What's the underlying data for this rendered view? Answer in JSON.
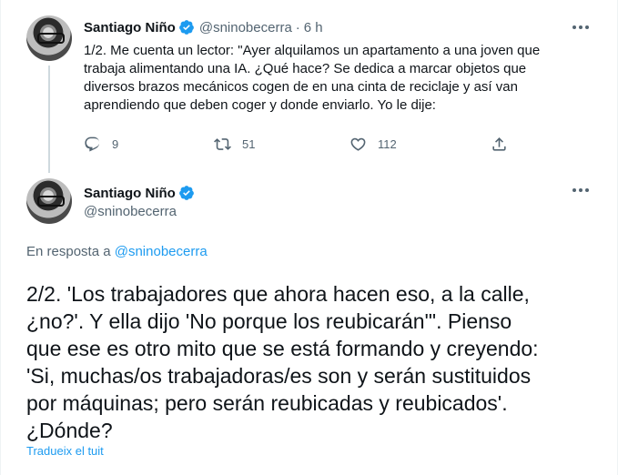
{
  "tweet1": {
    "author_name": "Santiago Niño",
    "handle": "@sninobecerra",
    "separator": "·",
    "time": "6 h",
    "text_lines": [
      "1/2. Me cuenta un lector: \"Ayer alquilamos un apartamento a una joven que",
      "trabaja alimentando una IA. ¿Qué hace? Se dedica a marcar objetos que",
      "diversos brazos mecánicos cogen de en una cinta de reciclaje  y así van",
      "aprendiendo que deben coger y donde enviarlo. Yo le dije:"
    ],
    "replies": "9",
    "retweets": "51",
    "likes": "112"
  },
  "tweet2": {
    "author_name": "Santiago Niño",
    "handle": "@sninobecerra",
    "reply_prefix": "En resposta a ",
    "reply_handle": "@sninobecerra",
    "text_lines": [
      "2/2. 'Los trabajadores que ahora hacen eso, a la calle,",
      "¿no?'. Y ella dijo 'No porque los reubicarán'\". Pienso",
      "que ese es otro mito que se está formando y creyendo:",
      "'Si, muchas/os trabajadoras/es son y serán sustituidos",
      "por máquinas; pero serán reubicadas y reubicados'.",
      "¿Dónde?"
    ],
    "translate_label": "Tradueix el tuit"
  },
  "icons": {
    "verified": "verified-badge-icon",
    "more": "more-options-icon",
    "reply": "reply-icon",
    "retweet": "retweet-icon",
    "like": "like-icon",
    "share": "share-icon"
  },
  "colors": {
    "accent": "#1d9bf0",
    "secondary_text": "#536471",
    "primary_text": "#0f1419",
    "thread_line": "#cfd9de"
  }
}
